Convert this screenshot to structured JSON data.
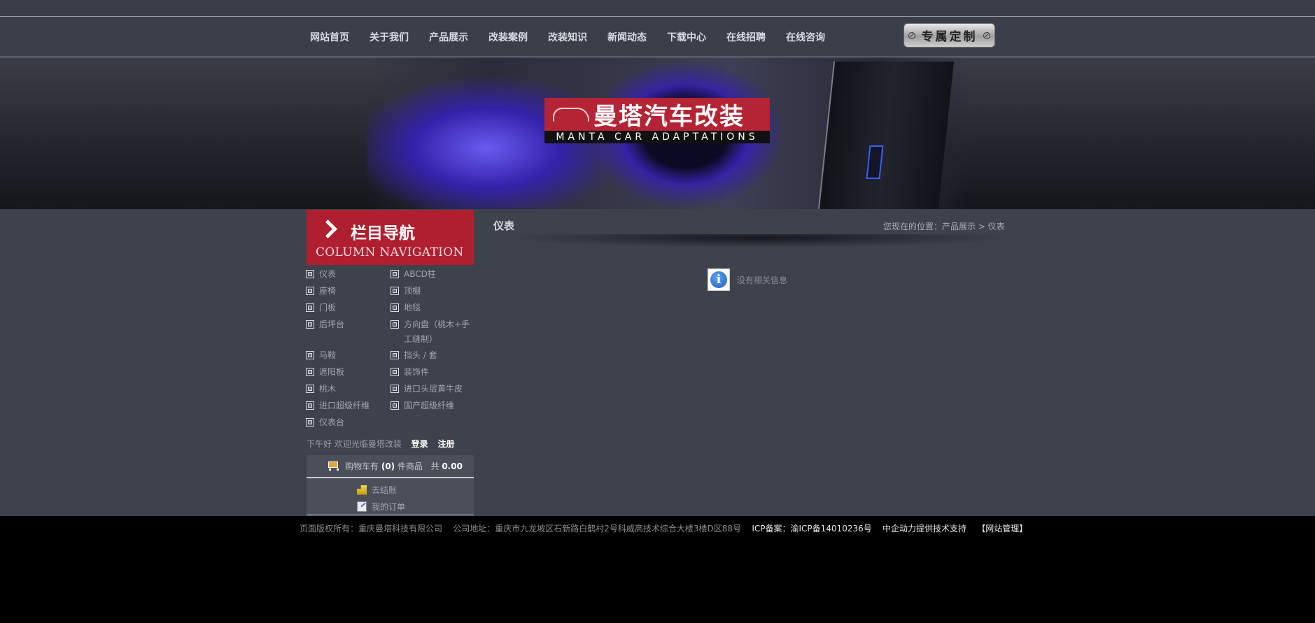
{
  "nav": {
    "items": [
      "网站首页",
      "关于我们",
      "产品展示",
      "改装案例",
      "改装知识",
      "新闻动态",
      "下载中心",
      "在线招聘",
      "在线咨询"
    ],
    "custom_label": "专属定制"
  },
  "banner": {
    "logo_cn": "曼塔汽车改装",
    "logo_en": "MANTA CAR ADAPTATIONS"
  },
  "sidebar": {
    "title_cn": "栏目导航",
    "title_en": "COLUMN NAVIGATION",
    "categories": [
      "仪表",
      "ABCD柱",
      "座椅",
      "顶棚",
      "门板",
      "地毯",
      "后坪台",
      "方向盘（桃木+手工缝制）",
      "马鞍",
      "挡头 / 套",
      "遮阳板",
      "装饰件",
      "桃木",
      "进口头层黄牛皮",
      "进口超级纤维",
      "国产超级纤维",
      "仪表台"
    ],
    "greeting": "下午好 欢迎光临曼塔改装",
    "login": "登录",
    "register": "注册",
    "cart": {
      "prefix": "购物车有",
      "count": "(0)",
      "unit": "件商品",
      "total_label": "共",
      "total": "0.00"
    },
    "checkout": "去结账",
    "orders": "我的订单"
  },
  "main": {
    "title": "仪表",
    "breadcrumb": "您现在的位置：产品展示 > 仪表",
    "empty_message": "没有相关信息"
  },
  "footer": {
    "copyright": "页面版权所有：重庆曼塔科技有限公司",
    "address": "公司地址：重庆市九龙坡区石新路白鹤村2号科威高技术综合大楼3楼D区88号",
    "icp": "ICP备案：渝ICP备14010236号",
    "support": "中企动力提供技术支持",
    "admin": "【网站管理】"
  },
  "colors": {
    "accent_red": "#b01f2f",
    "background": "#3e424d",
    "footer": "#000000"
  }
}
